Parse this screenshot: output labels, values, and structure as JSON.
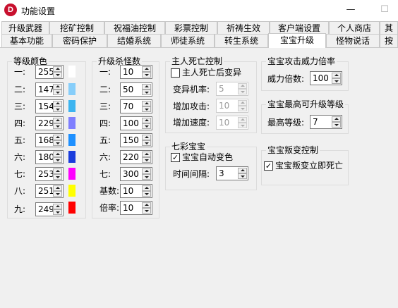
{
  "window": {
    "title": "功能设置",
    "icon_letter": "D",
    "minimize": "—",
    "maximize": "☐"
  },
  "tabs_row1": [
    "升级武器",
    "挖矿控制",
    "祝福油控制",
    "彩票控制",
    "祈祷生效",
    "客户端设置",
    "个人商店",
    "其"
  ],
  "tabs_row2": [
    "基本功能",
    "密码保护",
    "结婚系统",
    "师徒系统",
    "转生系统",
    "宝宝升级",
    "怪物说话",
    "按"
  ],
  "active_tab": "宝宝升级",
  "level_colors": {
    "title": "等级颜色",
    "rows": [
      {
        "label": "一:",
        "value": "255",
        "color": "#ffffff"
      },
      {
        "label": "二:",
        "value": "147",
        "color": "#87cefa"
      },
      {
        "label": "三:",
        "value": "154",
        "color": "#3cb4f0"
      },
      {
        "label": "四:",
        "value": "229",
        "color": "#7f7fff"
      },
      {
        "label": "五:",
        "value": "168",
        "color": "#1e90ff"
      },
      {
        "label": "六:",
        "value": "180",
        "color": "#1a3cdc"
      },
      {
        "label": "七:",
        "value": "253",
        "color": "#ff00ff"
      },
      {
        "label": "八:",
        "value": "251",
        "color": "#ffff00"
      },
      {
        "label": "九:",
        "value": "249",
        "color": "#ff0000"
      }
    ]
  },
  "kill_counts": {
    "title": "升级杀怪数",
    "rows": [
      {
        "label": "一:",
        "value": "10"
      },
      {
        "label": "二:",
        "value": "50"
      },
      {
        "label": "三:",
        "value": "70"
      },
      {
        "label": "四:",
        "value": "100"
      },
      {
        "label": "五:",
        "value": "150"
      },
      {
        "label": "六:",
        "value": "220"
      },
      {
        "label": "七:",
        "value": "300"
      },
      {
        "label": "基数:",
        "value": "10"
      },
      {
        "label": "倍率:",
        "value": "10"
      }
    ]
  },
  "master_death": {
    "title": "主人死亡控制",
    "checkbox_label": "主人死亡后变异",
    "checked": false,
    "rows": [
      {
        "label": "变异机率:",
        "value": "5"
      },
      {
        "label": "增加攻击:",
        "value": "10"
      },
      {
        "label": "增加速度:",
        "value": "10"
      }
    ]
  },
  "rainbow": {
    "title": "七彩宝宝",
    "checkbox_label": "宝宝自动变色",
    "checked": true,
    "interval_label": "时间间隔:",
    "interval_value": "3"
  },
  "attack_power": {
    "title": "宝宝攻击威力倍率",
    "label": "威力倍数:",
    "value": "100"
  },
  "max_level": {
    "title": "宝宝最高可升级等级",
    "label": "最高等级:",
    "value": "7"
  },
  "rebel": {
    "title": "宝宝叛变控制",
    "checkbox_label": "宝宝叛变立即死亡",
    "checked": true
  }
}
